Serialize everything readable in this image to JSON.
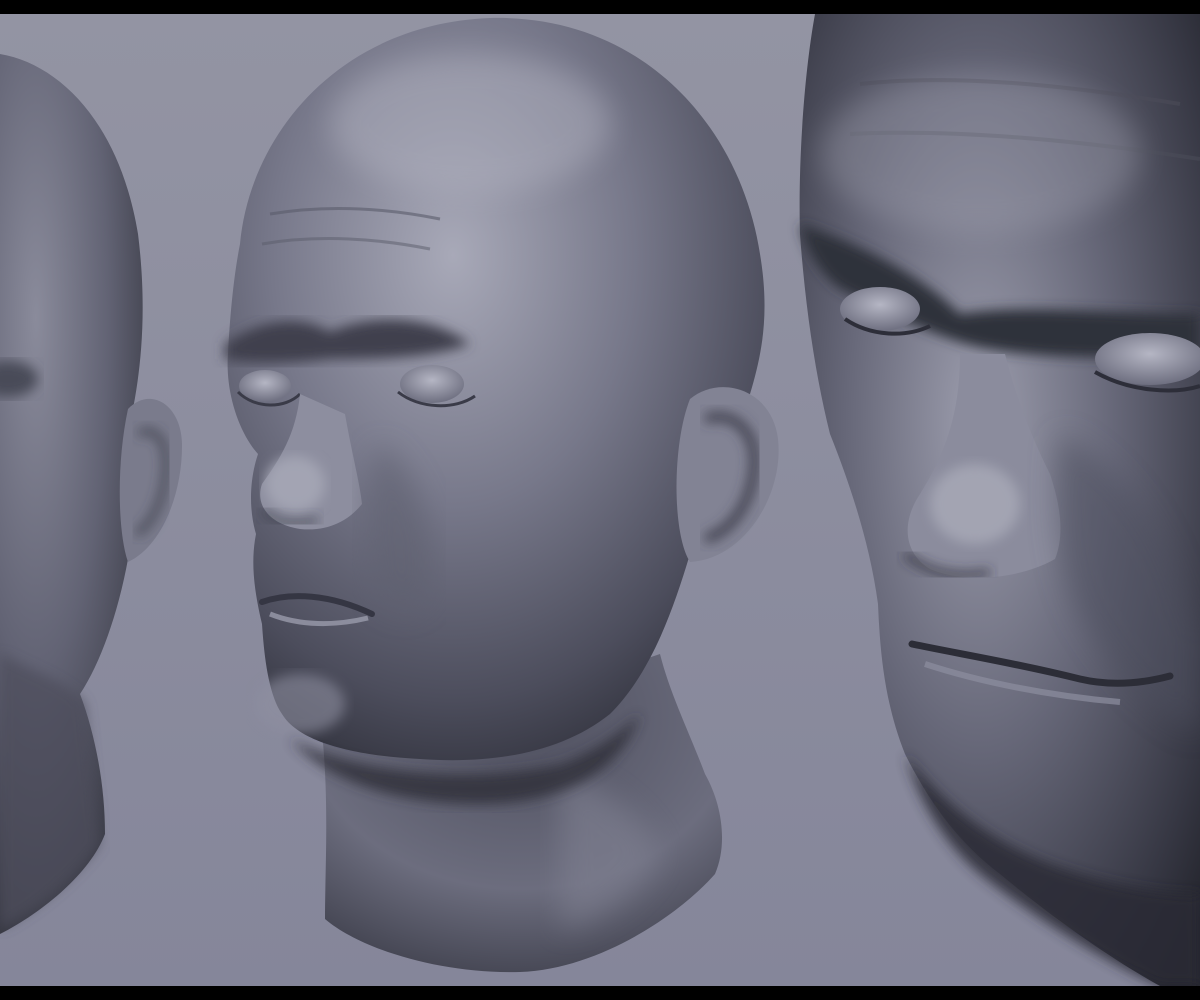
{
  "scene": {
    "background_color": "#8e8e9e",
    "letterbox_color": "#000000",
    "clay_base_color": "#6b6c7c",
    "clay_highlight_color": "#a6a7b6",
    "clay_shadow_color": "#2c2d36",
    "views": [
      {
        "id": "left",
        "icon": "sculpted-head-side-view"
      },
      {
        "id": "center",
        "icon": "sculpted-head-three-quarter-view"
      },
      {
        "id": "right",
        "icon": "sculpted-head-closeup-view"
      }
    ]
  }
}
